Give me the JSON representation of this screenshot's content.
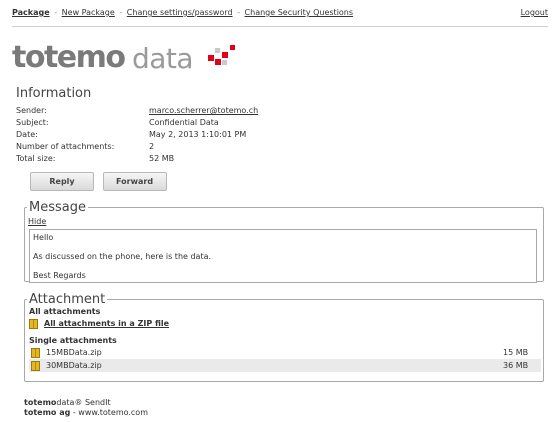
{
  "nav": {
    "package": "Package",
    "new_package": "New Package",
    "change_password": "Change settings/password",
    "change_security": "Change Security Questions",
    "separator": "-",
    "logout": "Logout"
  },
  "logo": {
    "word1": "totemo",
    "word2": "data"
  },
  "information": {
    "title": "Information",
    "rows": [
      {
        "label": "Sender:",
        "value": "marco.scherrer@totemo.ch"
      },
      {
        "label": "Subject:",
        "value": "Confidential Data"
      },
      {
        "label": "Date:",
        "value": "May 2, 2013 1:10:01 PM"
      },
      {
        "label": "Number of attachments:",
        "value": "2"
      },
      {
        "label": "Total size:",
        "value": "52 MB"
      }
    ]
  },
  "buttons": {
    "reply": "Reply",
    "forward": "Forward"
  },
  "message": {
    "legend": "Message",
    "hide": "Hide",
    "lines": [
      "Hello",
      "As discussed on the phone, here is the data.",
      "Best Regards"
    ]
  },
  "attachment": {
    "legend": "Attachment",
    "all_heading": "All attachments",
    "all_zip": "All attachments in a ZIP file",
    "single_heading": "Single attachments",
    "files": [
      {
        "name": "15MBData.zip",
        "size": "15 MB"
      },
      {
        "name": "30MBData.zip",
        "size": "36 MB"
      }
    ]
  },
  "footer": {
    "product_bold": "totemo",
    "product_rest": "data® SendIt",
    "company_bold": "totemo ag",
    "company_rest": "- www.totemo.com"
  },
  "colors": {
    "logo_gray": "#7a7a7a",
    "logo_red": "#e2001a"
  }
}
